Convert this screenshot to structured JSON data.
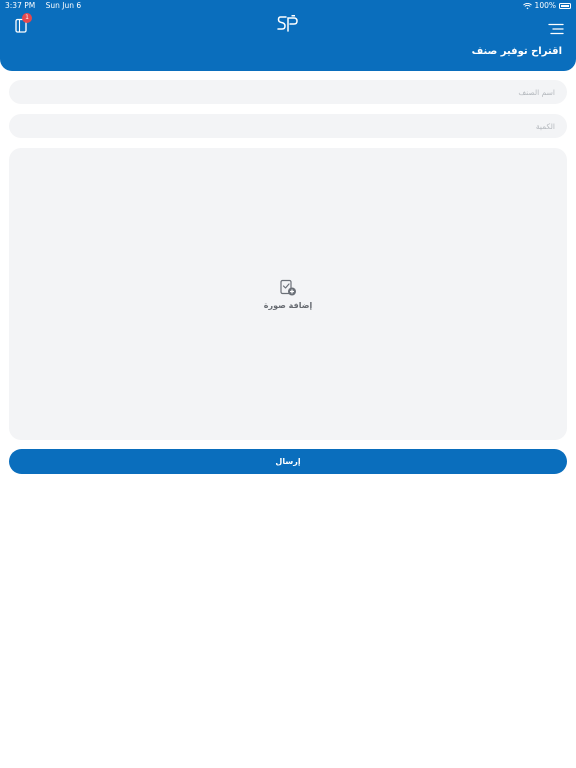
{
  "status_bar": {
    "time": "3:37 PM",
    "date": "Sun Jun 6",
    "battery": "100%"
  },
  "header": {
    "cart_badge_count": "1",
    "title": "اقتراح توفير صنف"
  },
  "form": {
    "item_name_placeholder": "اسم الصنف",
    "quantity_placeholder": "الكمية",
    "add_image_label": "إضافة صورة",
    "submit_label": "إرسال"
  },
  "colors": {
    "brand": "#0a6ebd",
    "field_bg": "#f3f4f6",
    "badge": "#e5484d"
  },
  "icons": {
    "cart": "cart-icon",
    "logo": "sp-logo",
    "menu": "menu-icon",
    "add_image": "add-image-icon"
  }
}
